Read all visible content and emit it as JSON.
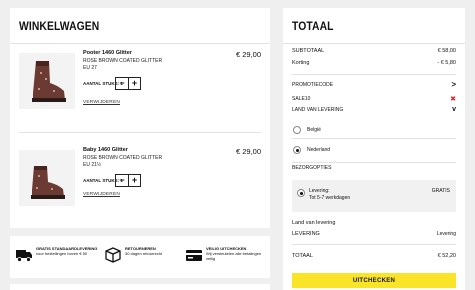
{
  "cart": {
    "title": "WINKELWAGEN",
    "items": [
      {
        "name": "Pooter 1460 Glitter",
        "color": "ROSE BROWN COATED GLITTER",
        "size": "EU 27",
        "price": "€ 29,00",
        "qty_label": "AANTAL STUKS: 1",
        "remove_label": "VERWIJDEREN"
      },
      {
        "name": "Baby 1460 Glitter",
        "color": "ROSE BROWN COATED GLITTER",
        "size": "EU 21½",
        "price": "€ 29,00",
        "qty_label": "AANTAL STUKS: 1",
        "remove_label": "VERWIJDEREN"
      }
    ],
    "stepper": {
      "minus": "−",
      "plus": "+"
    }
  },
  "perks": [
    {
      "title": "GRATIS STANDAARDLEVERING",
      "desc": "voor bestellingen boven € 50",
      "icon": "truck-icon"
    },
    {
      "title": "RETOURNEREN",
      "desc": "30 dagen retourrecht",
      "icon": "box-icon"
    },
    {
      "title": "VEILIG UITCHECKEN",
      "desc": "Wij versleutelen alle betalingen veilig",
      "icon": "card-icon"
    }
  ],
  "summary": {
    "title": "TOTAAL",
    "subtotal_label": "SUBTOTAAL",
    "subtotal_value": "€ 58,00",
    "discount_label": "Korting",
    "discount_value": "- € 5,80",
    "promo_label": "PROMOTIECODE",
    "promo_chevron": ">",
    "promo_code": "SALE10",
    "promo_remove": "✖",
    "country_label": "LAND VAN LEVERING",
    "country_chevron": "v",
    "countries": [
      {
        "label": "België",
        "selected": false
      },
      {
        "label": "Nederland",
        "selected": true
      }
    ],
    "delivery_options_label": "BEZORGOPTIES",
    "delivery_option": {
      "name": "Levering:",
      "eta": "Tot 5-7 werkdagen",
      "price": "GRATIS",
      "selected": true
    },
    "land_heading": "Land van levering",
    "levering_label": "LEVERING",
    "levering_value": "Levering",
    "total_label": "TOTAAL",
    "total_value": "€ 52,20",
    "checkout_label": "UITCHECKEN"
  },
  "colors": {
    "accent": "#f9e427",
    "remove": "#e02020",
    "background": "#efefef"
  }
}
